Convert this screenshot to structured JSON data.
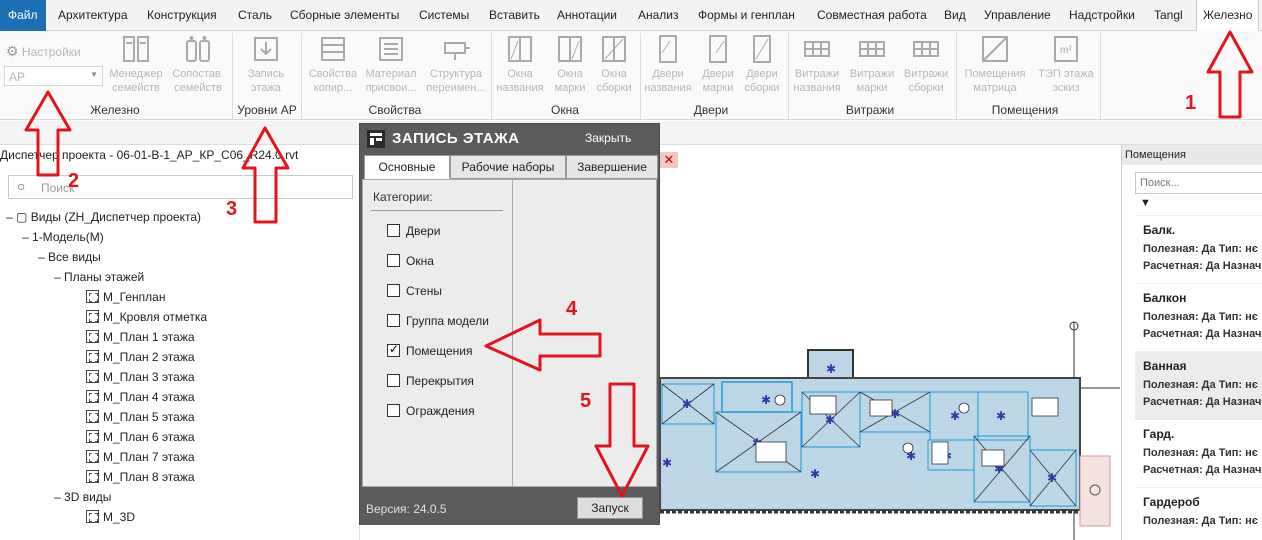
{
  "menu": {
    "file": "Файл",
    "tabs": [
      "Архитектура",
      "Конструкция",
      "Сталь",
      "Сборные элементы",
      "Системы",
      "Вставить",
      "Аннотации",
      "Анализ",
      "Формы и генплан",
      "Совместная работа",
      "Вид",
      "Управление",
      "Надстройки",
      "Tangl",
      "Железно"
    ],
    "active": "Железно"
  },
  "ribbon": {
    "settings_label": "Настройки",
    "combo_value": "АР",
    "buttons": {
      "family_manager": [
        "Менеджер",
        "семейств"
      ],
      "family_compare": [
        "Сопостав.",
        "семейств"
      ],
      "level_write": [
        "Запись",
        "этажа"
      ],
      "props_copy": [
        "Свойства",
        "копир..."
      ],
      "mat_rename": [
        "Материал",
        "приcвои..."
      ],
      "struct_rename": [
        "Структура",
        "переимен..."
      ],
      "win_names": [
        "Окна",
        "названия"
      ],
      "win_marks": [
        "Окна",
        "марки"
      ],
      "win_assy": [
        "Окна",
        "сборки"
      ],
      "door_names": [
        "Двери",
        "названия"
      ],
      "door_marks": [
        "Двери",
        "марки"
      ],
      "door_assy": [
        "Двери",
        "сборки"
      ],
      "vit_names": [
        "Витражи",
        "названия"
      ],
      "vit_marks": [
        "Витражи",
        "марки"
      ],
      "vit_assy": [
        "Витражи",
        "сборки"
      ],
      "rooms_matrix": [
        "Помещения",
        "матрица"
      ],
      "tep": [
        "ТЭП этажа",
        "эскиз"
      ]
    },
    "panels": {
      "zhelezno": "Железно",
      "levels": "Уровни АР",
      "props": "Свойства",
      "windows": "Окна",
      "doors": "Двери",
      "vitrazhi": "Витражи",
      "rooms": "Помещения"
    }
  },
  "browser": {
    "title": "Диспетчер проекта - 06-01-В-1_АР_КР_С06_R24.0.rvt",
    "search_placeholder": "Поиск",
    "root": "Виды (ZH_Диспетчер проекта)",
    "model": "1-Модель(М)",
    "all_views": "Все виды",
    "floor_plans": "Планы этажей",
    "plans": [
      "М_Генплан",
      "М_Кровля отметка",
      "М_План 1 этажа",
      "М_План 2 этажа",
      "М_План 3 этажа",
      "М_План 4 этажа",
      "М_План 5 этажа",
      "М_План 6 этажа",
      "М_План 7 этажа",
      "М_План 8 этажа"
    ],
    "views3d": "3D виды",
    "view3d_item": "М_3D"
  },
  "dialog": {
    "title": "ЗАПИСЬ ЭТАЖА",
    "close": "Закрыть",
    "tabs": [
      "Основные",
      "Рабочие наборы",
      "Завершение"
    ],
    "categories_label": "Категории:",
    "categories": [
      {
        "label": "Двери",
        "checked": false
      },
      {
        "label": "Окна",
        "checked": false
      },
      {
        "label": "Стены",
        "checked": false
      },
      {
        "label": "Группа модели",
        "checked": false
      },
      {
        "label": "Помещения",
        "checked": true
      },
      {
        "label": "Перекрытия",
        "checked": false
      },
      {
        "label": "Ограждения",
        "checked": false
      }
    ],
    "version": "Версия: 24.0.5",
    "run": "Запуск"
  },
  "rooms_panel": {
    "title": "Помещения",
    "search_placeholder": "Поиск...",
    "items": [
      {
        "name": "Балк.",
        "line1": "Полезная: Да Тип: нє",
        "line2": "Расчетная: Да Назнач"
      },
      {
        "name": "Балкон",
        "line1": "Полезная: Да Тип: нє",
        "line2": "Расчетная: Да Назнач"
      },
      {
        "name": "Ванная",
        "line1": "Полезная: Да Тип: нє",
        "line2": "Расчетная: Да Назнач"
      },
      {
        "name": "Гард.",
        "line1": "Полезная: Да Тип: нє",
        "line2": "Расчетная: Да Назнач"
      },
      {
        "name": "Гардероб",
        "line1": "Полезная: Да Тип: нє",
        "line2": ""
      }
    ]
  },
  "annotations": [
    "1",
    "2",
    "3",
    "4",
    "5"
  ],
  "colors": {
    "accent": "#1a6fb5",
    "annotation": "#e3141e",
    "room_fill": "#bcd6e6",
    "dialog": "#5b5b5b"
  }
}
